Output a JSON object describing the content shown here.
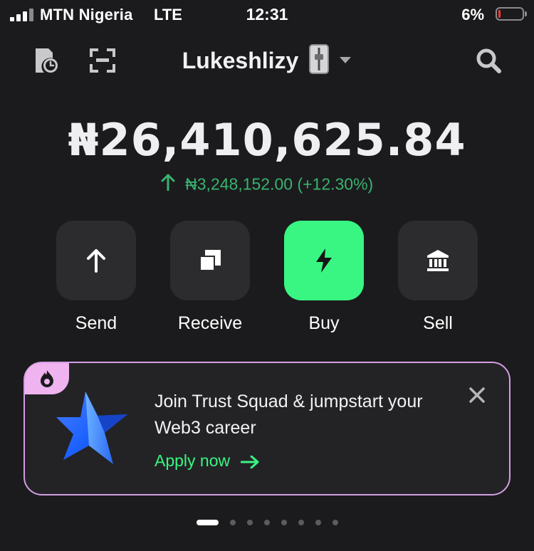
{
  "status_bar": {
    "carrier": "MTN Nigeria",
    "network": "LTE",
    "time": "12:31",
    "battery_percent": "6%",
    "battery_level": 0.06,
    "battery_color": "#ff3b30"
  },
  "header": {
    "wallet_name": "Lukeshlizy",
    "left_icons": [
      "history-icon",
      "scan-icon"
    ],
    "right_icon": "search-icon"
  },
  "balance": {
    "total": "₦26,410,625.84",
    "change_text": "₦3,248,152.00 (+12.30%)",
    "change_color": "#38b36f"
  },
  "actions": [
    {
      "label": "Send",
      "icon": "arrow-up-icon"
    },
    {
      "label": "Receive",
      "icon": "copy-icon"
    },
    {
      "label": "Buy",
      "icon": "lightning-icon",
      "highlight_color": "#39f682"
    },
    {
      "label": "Sell",
      "icon": "bank-icon"
    }
  ],
  "promo": {
    "title": "Join Trust Squad & jumpstart your Web3 career",
    "cta": "Apply now",
    "border_color": "#d49de2",
    "tag_color": "#efb3ef"
  },
  "pager": {
    "total": 8,
    "active": 1
  }
}
